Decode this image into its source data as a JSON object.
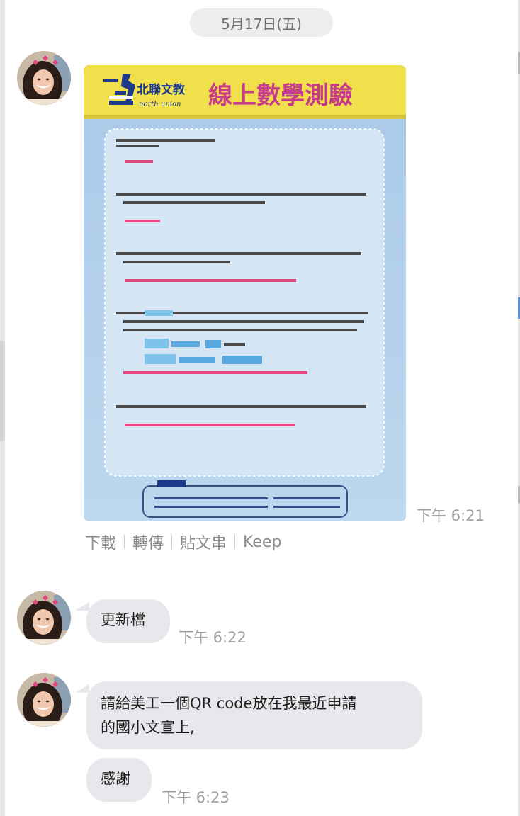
{
  "date_separator": "5月17日(五)",
  "image_message": {
    "header_brand_cn": "北聯文教",
    "header_brand_en": "north union",
    "header_title": "線上數學測驗",
    "timestamp": "下午 6:21"
  },
  "image_actions": [
    {
      "label": "下載"
    },
    {
      "label": "轉傳"
    },
    {
      "label": "貼文串"
    },
    {
      "label": "Keep"
    }
  ],
  "messages": [
    {
      "text_lines": [
        "更新檔"
      ],
      "timestamp": "下午 6:22"
    },
    {
      "text_lines": [
        "請給美工一個QR code放在我最近申請",
        "的國小文宣上,"
      ],
      "timestamp": ""
    },
    {
      "text_lines": [
        "感謝"
      ],
      "timestamp": "下午 6:23"
    }
  ],
  "colors": {
    "bubble": "#e6e8eb",
    "flyer_header": "#f2df4c",
    "flyer_title": "#c63c8a",
    "answer_text": "#d8376f",
    "brand_blue": "#1e3a8a"
  }
}
